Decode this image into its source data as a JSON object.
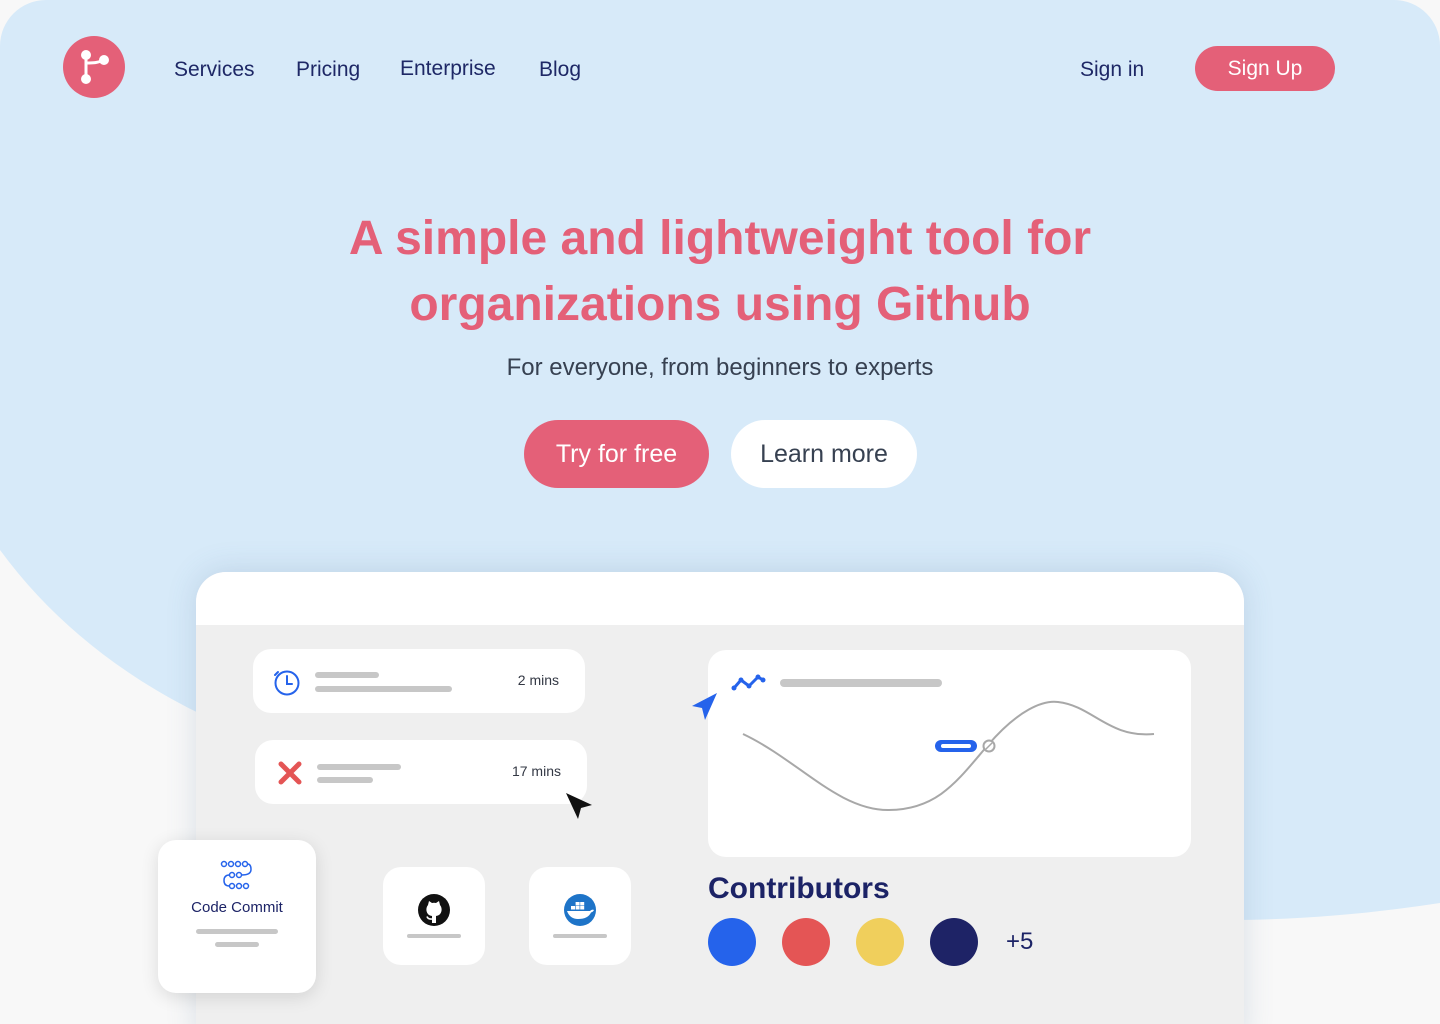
{
  "nav": {
    "logo_icon": "git-branch-icon",
    "links": [
      "Services",
      "Pricing",
      "Enterprise",
      "Blog"
    ],
    "sign_in": "Sign in",
    "sign_up": "Sign Up"
  },
  "hero": {
    "title_line1": "A simple and lightweight tool for",
    "title_line2": "organizations using Github",
    "subtitle": "For everyone, from beginners to experts",
    "primary_cta": "Try for free",
    "secondary_cta": "Learn more"
  },
  "dashboard": {
    "jobs": [
      {
        "icon": "clock-icon",
        "time": "2 mins"
      },
      {
        "icon": "failed-x-icon",
        "time": "17 mins"
      }
    ],
    "integrations": [
      {
        "icon": "github-icon"
      },
      {
        "icon": "docker-icon"
      }
    ],
    "code_commit_label": "Code Commit",
    "chart_icon": "line-chart-icon",
    "contributors": {
      "title": "Contributors",
      "avatars": [
        "#2563eb",
        "#e45555",
        "#f0cf5c",
        "#1e2366"
      ],
      "more": "+5"
    }
  },
  "colors": {
    "brand": "#e46078",
    "background": "#d7eaf9",
    "navy": "#1e2866"
  }
}
